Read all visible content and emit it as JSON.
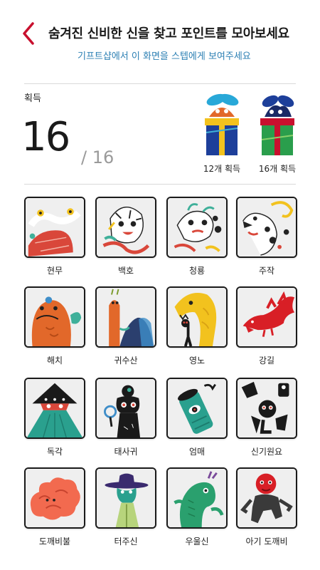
{
  "header": {
    "title": "숨겨진 신비한 신을 찾고 포인트를 모아보세요",
    "subtitle": "기프트샵에서 이 화면을 스텝에게 보여주세요"
  },
  "summary": {
    "label": "획득",
    "count": "16",
    "total": "/ 16"
  },
  "rewards": [
    {
      "label": "12개 획득",
      "icon": "gift-box-blue-icon"
    },
    {
      "label": "16개 획득",
      "icon": "gift-box-green-icon"
    }
  ],
  "colors": {
    "accent_red": "#c8102e",
    "subtitle_blue": "#2b7fb3"
  },
  "creatures": [
    {
      "name": "현무"
    },
    {
      "name": "백호"
    },
    {
      "name": "청룡"
    },
    {
      "name": "주작"
    },
    {
      "name": "해치"
    },
    {
      "name": "귀수산"
    },
    {
      "name": "영노"
    },
    {
      "name": "강길"
    },
    {
      "name": "독각"
    },
    {
      "name": "태사귀"
    },
    {
      "name": "엄매"
    },
    {
      "name": "신기원요"
    },
    {
      "name": "도깨비불"
    },
    {
      "name": "터주신"
    },
    {
      "name": "우울신"
    },
    {
      "name": "아기 도깨비"
    }
  ]
}
